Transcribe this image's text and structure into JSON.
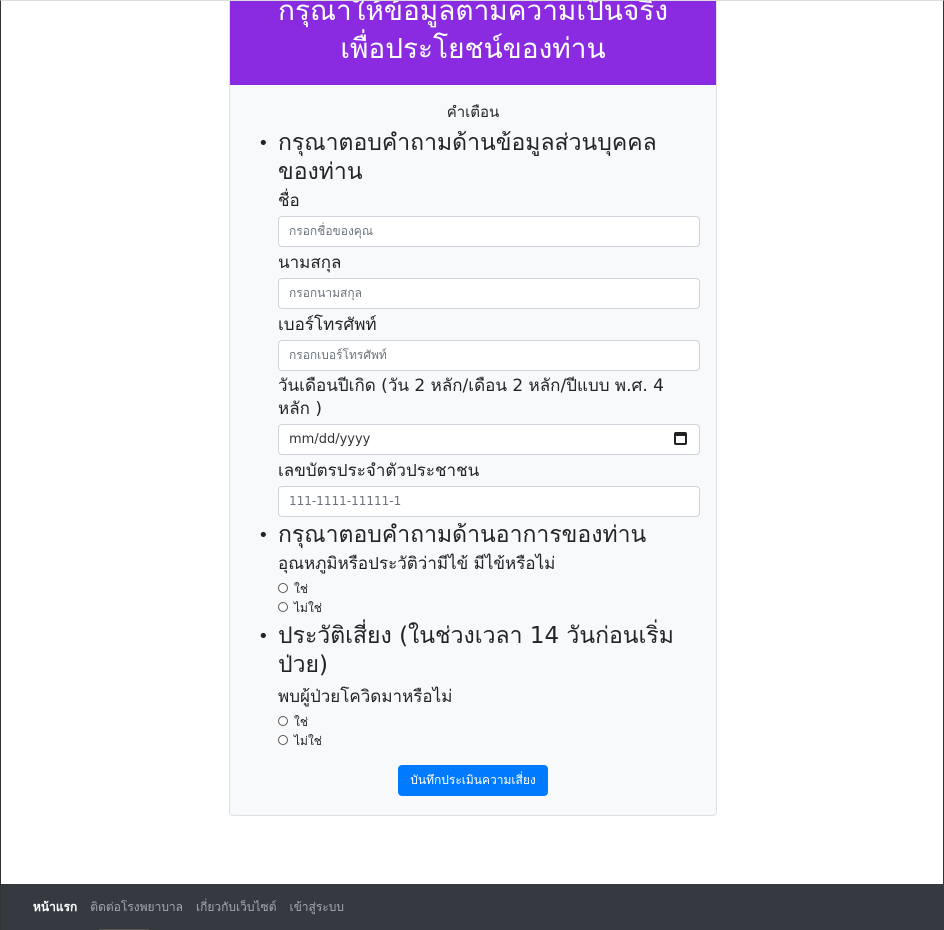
{
  "header": {
    "line1": "กรุณาให้ข้อมูลตามความเป็นจริง",
    "line2": "เพื่อประโยชน์ของท่าน"
  },
  "warning_title": "คำเตือน",
  "personal": {
    "heading": "กรุณาตอบคำถามด้านข้อมูลส่วนบุคคลของท่าน",
    "first_name_label": "ชื่อ",
    "first_name_placeholder": "กรอกชื่อของคุณ",
    "last_name_label": "นามสกุล",
    "last_name_placeholder": "กรอกนามสกุล",
    "phone_label": "เบอร์โทรศัพท์",
    "phone_placeholder": "กรอกเบอร์โทรศัพท์",
    "dob_label": "วันเดือนปีเกิด (วัน 2 หลัก/เดือน 2 หลัก/ปีแบบ พ.ศ. 4 หลัก )",
    "dob_placeholder": "mm/dd/yyyy",
    "id_label": "เลขบัตรประจำตัวประชาชน",
    "id_placeholder": "111-1111-11111-1"
  },
  "symptoms": {
    "heading": "กรุณาตอบคำถามด้านอาการของท่าน",
    "question": "อุณหภูมิหรือประวัติว่ามีไข้ มีไข้หรือไม่",
    "yes": "ใช่",
    "no": "ไม่ใช่"
  },
  "risk": {
    "heading": "ประวัติเสี่ยง (ในช่วงเวลา 14 วันก่อนเริ่มป่วย)",
    "question": "พบผู้ป่วยโควิดมาหรือไม่",
    "yes": "ใช่",
    "no": "ไม่ใช่"
  },
  "submit_label": "บันทึกประเมินความเสี่ยง",
  "footer_nav": {
    "home": "หน้าแรก",
    "contact": "ติดต่อโรงพยาบาล",
    "about": "เกี่ยวกับเว็บไซต์",
    "login": "เข้าสู่ระบบ"
  },
  "colors": {
    "header_bg": "#8a2be2",
    "button_bg": "#007bff",
    "footer_bg": "#343a40"
  }
}
